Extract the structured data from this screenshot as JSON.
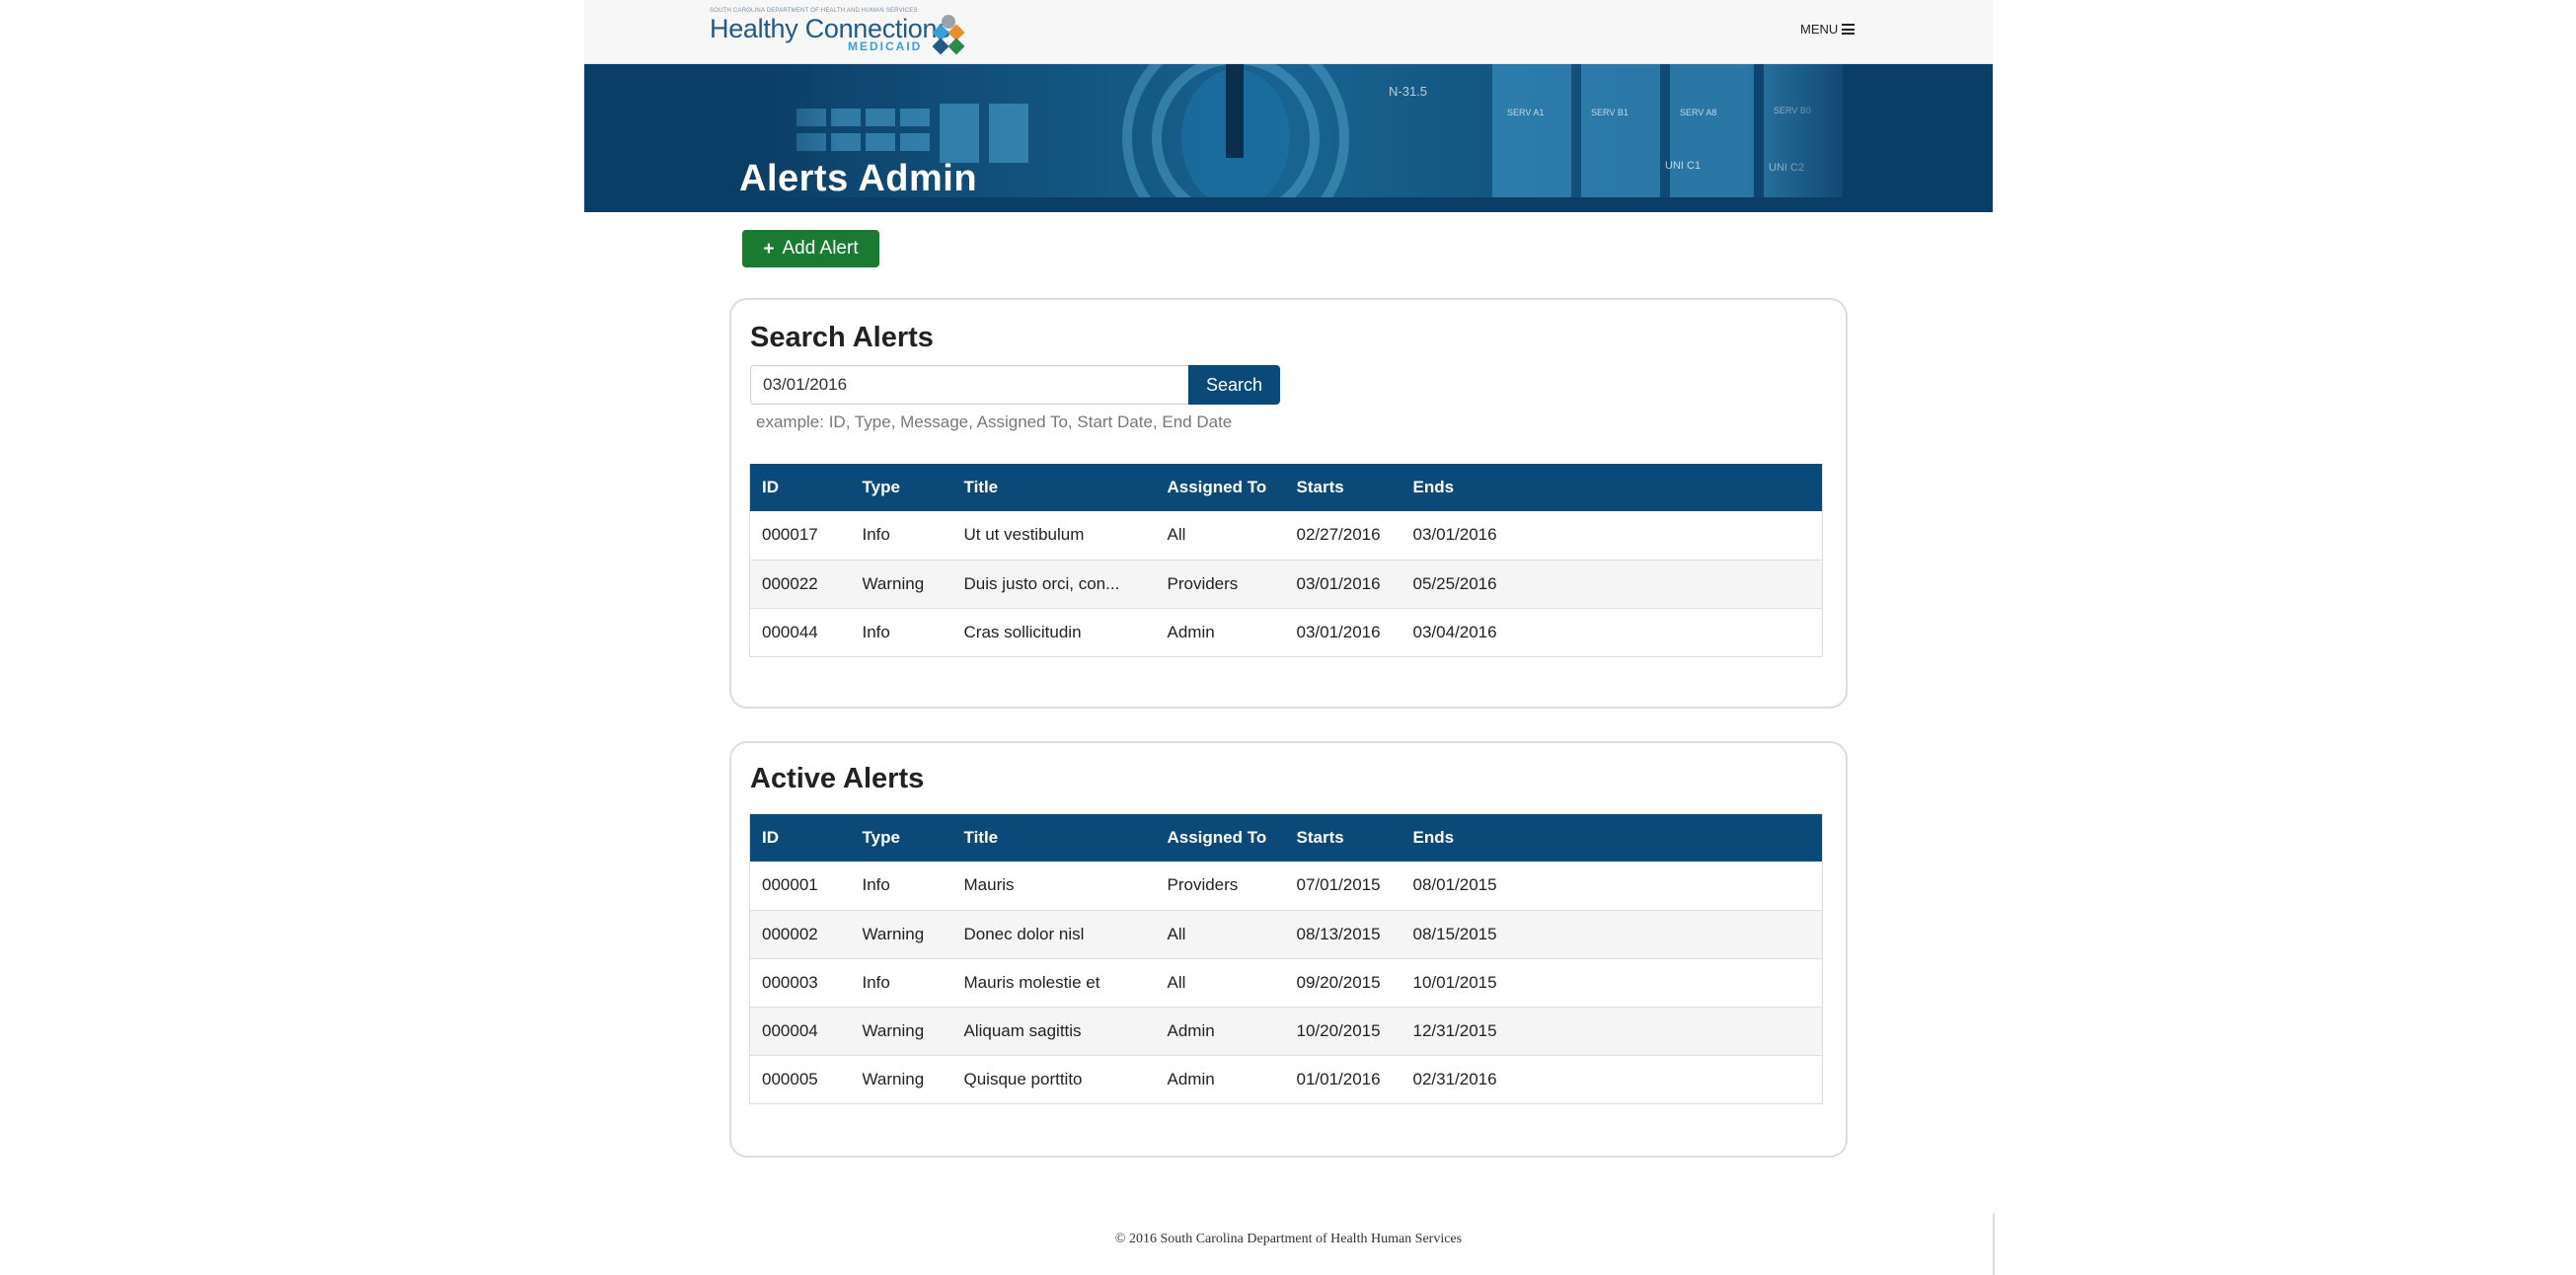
{
  "header": {
    "logo": {
      "small_text": "SOUTH CAROLINA DEPARTMENT OF HEALTH AND HUMAN SERVICES",
      "main_text": "Healthy Connections",
      "sub_text": "MEDICAID"
    },
    "menu_label": "MENU"
  },
  "banner": {
    "title": "Alerts Admin"
  },
  "actions": {
    "add_alert_label": "Add Alert"
  },
  "search_panel": {
    "title": "Search Alerts",
    "input_value": "03/01/2016",
    "search_button": "Search",
    "hint": "example: ID, Type, Message, Assigned To, Start Date, End Date",
    "columns": [
      "ID",
      "Type",
      "Title",
      "Assigned To",
      "Starts",
      "Ends"
    ],
    "rows": [
      [
        "000017",
        "Info",
        "Ut ut vestibulum",
        "All",
        "02/27/2016",
        "03/01/2016"
      ],
      [
        "000022",
        "Warning",
        "Duis justo orci, con...",
        "Providers",
        "03/01/2016",
        "05/25/2016"
      ],
      [
        "000044",
        "Info",
        "Cras sollicitudin",
        "Admin",
        "03/01/2016",
        "03/04/2016"
      ]
    ]
  },
  "active_panel": {
    "title": "Active Alerts",
    "columns": [
      "ID",
      "Type",
      "Title",
      "Assigned To",
      "Starts",
      "Ends"
    ],
    "rows": [
      [
        "000001",
        "Info",
        "Mauris",
        "Providers",
        "07/01/2015",
        "08/01/2015"
      ],
      [
        "000002",
        "Warning",
        "Donec dolor nisl",
        "All",
        "08/13/2015",
        "08/15/2015"
      ],
      [
        "000003",
        "Info",
        "Mauris molestie et",
        "All",
        "09/20/2015",
        "10/01/2015"
      ],
      [
        "000004",
        "Warning",
        "Aliquam sagittis",
        "Admin",
        "10/20/2015",
        "12/31/2015"
      ],
      [
        "000005",
        "Warning",
        "Quisque porttito",
        "Admin",
        "01/01/2016",
        "02/31/2016"
      ]
    ]
  },
  "footer": {
    "text": "© 2016 South Carolina Department of Health Human Services"
  },
  "colors": {
    "brand_navy": "#0b4a78",
    "add_green": "#1a7a31",
    "logo_blue": "#1f5a8a"
  }
}
